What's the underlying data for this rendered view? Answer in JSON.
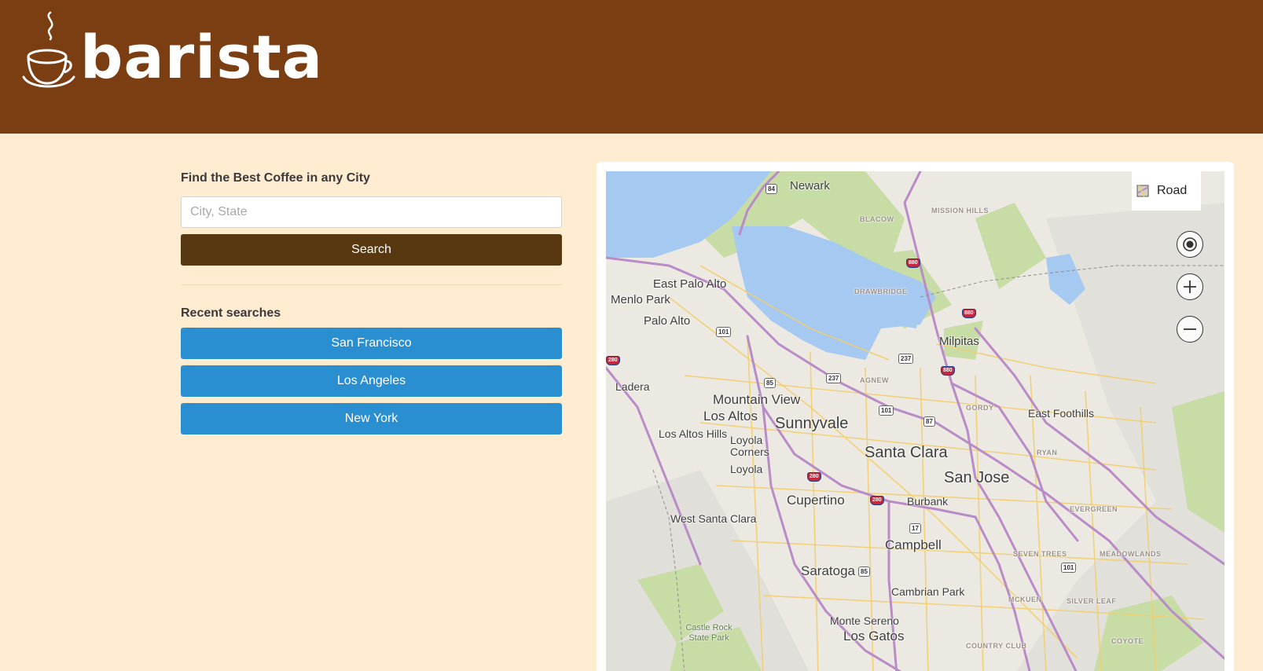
{
  "brand": {
    "name": "barista",
    "logo_icon": "coffee-cup-icon"
  },
  "search": {
    "title": "Find the Best Coffee in any City",
    "placeholder": "City, State",
    "value": "",
    "button_label": "Search"
  },
  "recent": {
    "title": "Recent searches",
    "items": [
      "San Francisco",
      "Los Angeles",
      "New York"
    ]
  },
  "map": {
    "road_toggle_label": "Road",
    "controls": [
      "locate-icon",
      "zoom-in-icon",
      "zoom-out-icon"
    ],
    "cities": [
      "Newark",
      "East Palo Alto",
      "Menlo Park",
      "Palo Alto",
      "Milpitas",
      "Ladera",
      "Mountain View",
      "Los Altos",
      "Sunnyvale",
      "Los Altos Hills",
      "Loyola Corners",
      "Loyola",
      "Santa Clara",
      "San Jose",
      "East Foothills",
      "Cupertino",
      "Burbank",
      "West Santa Clara",
      "Campbell",
      "Saratoga",
      "Cambrian Park",
      "Monte Sereno",
      "Los Gatos",
      "Castle Rock State Park"
    ],
    "neighborhoods": [
      "BLACOW",
      "MISSION HILLS",
      "DRAWBRIDGE",
      "AGNEW",
      "GORDY",
      "RYAN",
      "EVERGREEN",
      "SEVEN TREES",
      "MEADOWLANDS",
      "MCKUEN",
      "SILVER LEAF",
      "COUNTRY CLUB",
      "COYOTE"
    ],
    "highway_shields": [
      "84",
      "880",
      "101",
      "237",
      "85",
      "87",
      "280",
      "17"
    ]
  },
  "colors": {
    "header_bg": "#7b3d12",
    "page_bg": "#ffecd1",
    "search_button": "#573810",
    "recent_button": "#2a8fd0",
    "water": "#a5c9f0",
    "park": "#c8dca6",
    "highway": "#b98bc7",
    "arterial": "#f2cf6d"
  }
}
